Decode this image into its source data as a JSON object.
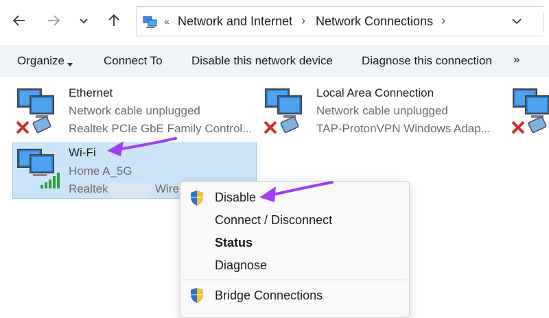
{
  "address": {
    "separator_first": "«",
    "crumb_1": "Network and Internet",
    "crumb_sep": "›",
    "crumb_2": "Network Connections",
    "crumb_end": "›"
  },
  "toolbar": {
    "organize": "Organize",
    "connect_to": "Connect To",
    "disable_device": "Disable this network device",
    "diagnose": "Diagnose this connection",
    "more": "»"
  },
  "connections": [
    {
      "name": "Ethernet",
      "status": "Network cable unplugged",
      "device": "Realtek PCIe GbE Family Control..."
    },
    {
      "name": "Local Area Connection",
      "status": "Network cable unplugged",
      "device": "TAP-ProtonVPN Windows Adap..."
    },
    {
      "name": "Wi-Fi",
      "status": "Home A_5G",
      "device_prefix": "Realtek",
      "device_suffix": "Wire"
    }
  ],
  "context_menu": {
    "disable": "Disable",
    "connect_disconnect": "Connect / Disconnect",
    "status": "Status",
    "diagnose": "Diagnose",
    "bridge": "Bridge Connections"
  },
  "colors": {
    "selection": "#cce4f7",
    "annotation_arrow": "#a23ff0",
    "command_bar": "#eef3f8"
  }
}
